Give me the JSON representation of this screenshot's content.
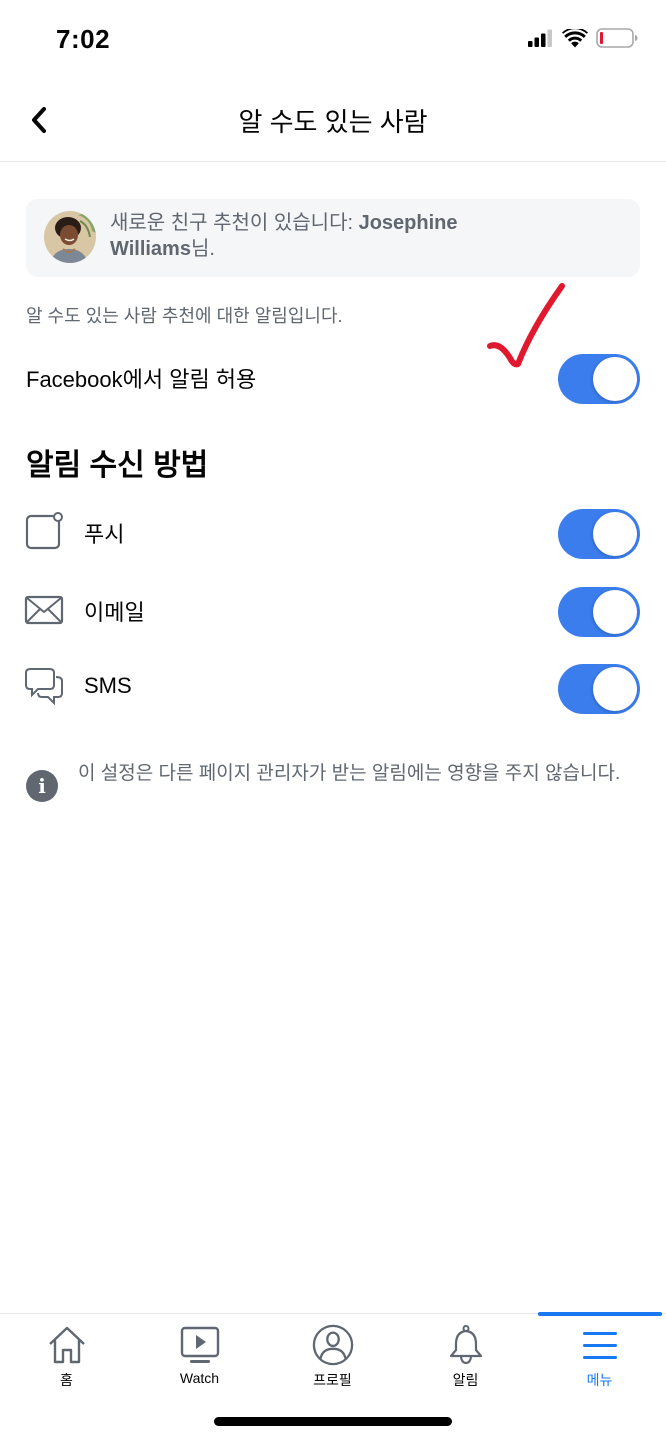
{
  "status_bar": {
    "time": "7:02",
    "icons": [
      "cellular-signal-icon",
      "wifi-icon",
      "battery-low-icon"
    ]
  },
  "header": {
    "title": "알 수도 있는 사람",
    "back_icon": "chevron-left-icon"
  },
  "suggestion_card": {
    "prefix": "새로운 친구 추천이 있습니다: ",
    "name": "Josephine Williams",
    "suffix": "님."
  },
  "description": "알 수도 있는 사람 추천에 대한 알림입니다.",
  "allow_row": {
    "label": "Facebook에서 알림 허용",
    "enabled": true
  },
  "methods_section": {
    "title": "알림 수신 방법",
    "items": [
      {
        "label": "푸시",
        "icon": "push-notification-icon",
        "enabled": true
      },
      {
        "label": "이메일",
        "icon": "envelope-icon",
        "enabled": true
      },
      {
        "label": "SMS",
        "icon": "chat-bubbles-icon",
        "enabled": true
      }
    ]
  },
  "info": {
    "icon": "info-icon",
    "text": "이 설정은 다른 페이지 관리자가 받는 알림에는 영향을 주지 않습니다."
  },
  "annotation": {
    "type": "red-checkmark",
    "color": "#e0192f"
  },
  "colors": {
    "accent": "#1877f2",
    "toggle_on": "#3b7ded",
    "secondary_text": "#606770",
    "card_bg": "#f5f6f7"
  },
  "tabbar": {
    "active_index": 4,
    "tabs": [
      {
        "label": "홈",
        "icon": "home-icon"
      },
      {
        "label": "Watch",
        "icon": "watch-video-icon"
      },
      {
        "label": "프로필",
        "icon": "profile-icon"
      },
      {
        "label": "알림",
        "icon": "bell-icon"
      },
      {
        "label": "메뉴",
        "icon": "menu-icon"
      }
    ]
  }
}
